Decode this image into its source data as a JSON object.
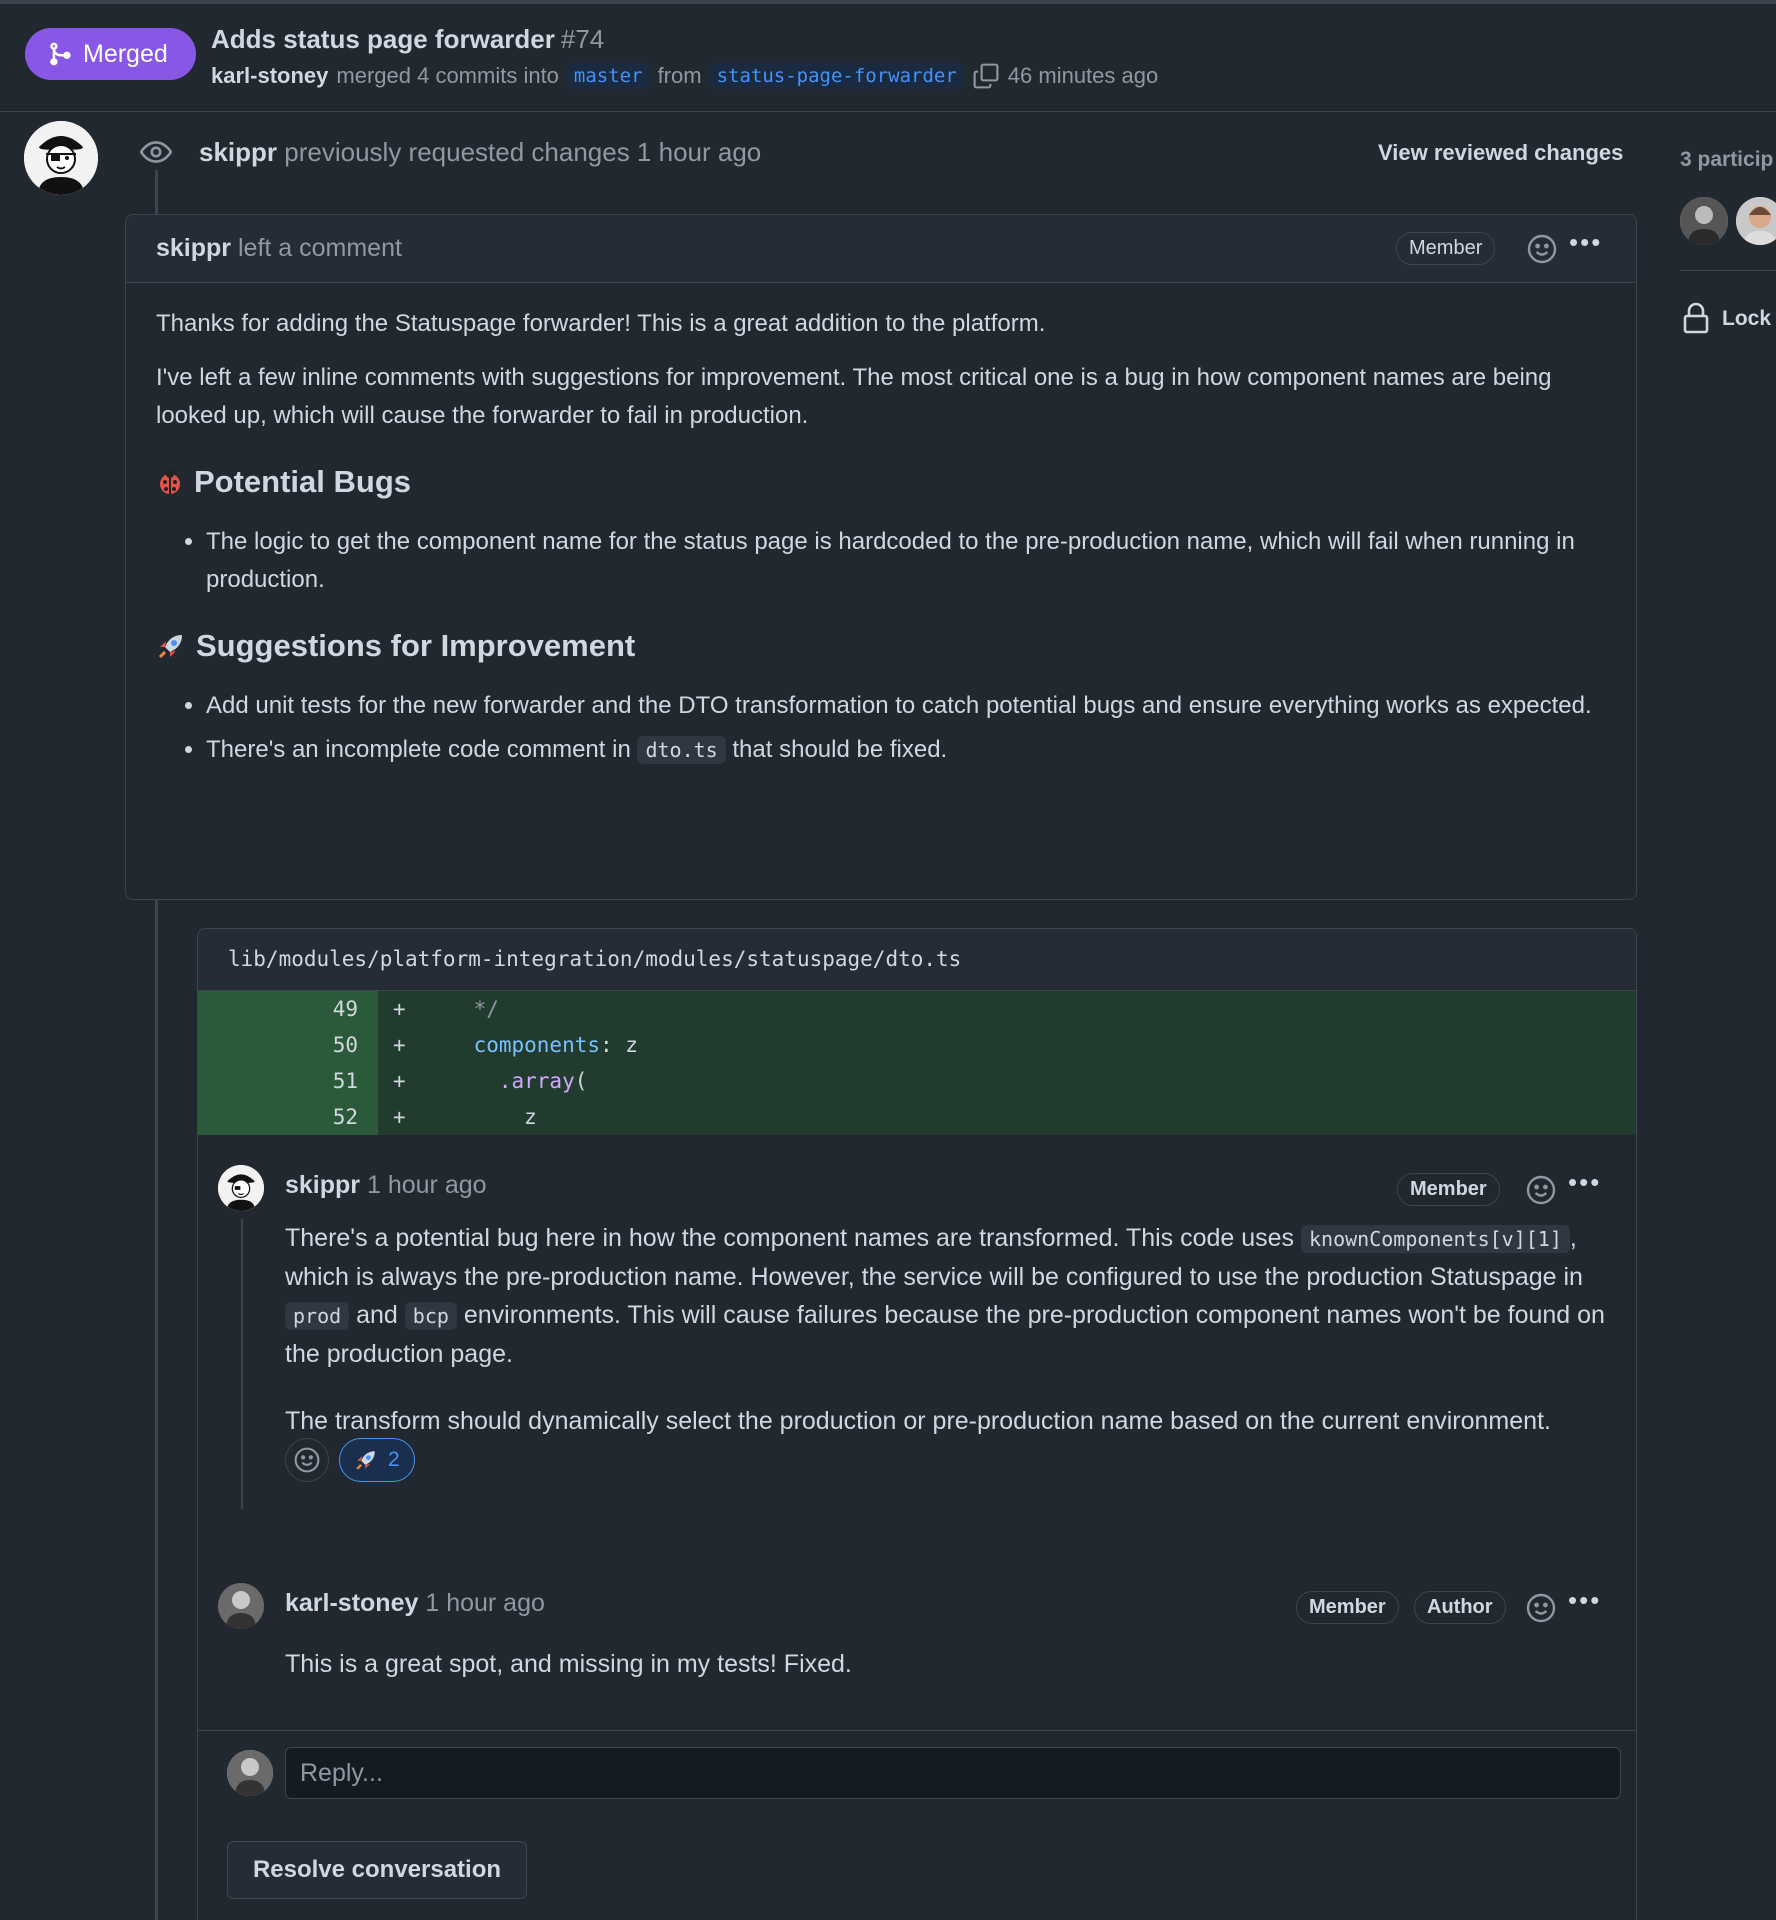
{
  "pr": {
    "status": "Merged",
    "title": "Adds status page forwarder",
    "number": "#74",
    "author": "karl-stoney",
    "merged_text": "merged 4 commits into",
    "base_branch": "master",
    "from_text": "from",
    "head_branch": "status-page-forwarder",
    "time": "46 minutes ago"
  },
  "review_event": {
    "user": "skippr",
    "text": "previously requested changes 1 hour ago",
    "view_link": "View reviewed changes"
  },
  "review": {
    "user": "skippr",
    "action": "left a comment",
    "badge": "Member",
    "p1": "Thanks for adding the Statuspage forwarder! This is a great addition to the platform.",
    "p2": "I've left a few inline comments with suggestions for improvement. The most critical one is a bug in how component names are being looked up, which will cause the forwarder to fail in production.",
    "h_bugs": "Potential Bugs",
    "bug_1": "The logic to get the component name for the status page is hardcoded to the pre-production name, which will fail when running in production.",
    "h_suggestions": "Suggestions for Improvement",
    "sugg_1": "Add unit tests for the new forwarder and the DTO transformation to catch potential bugs and ensure everything works as expected.",
    "sugg_2_pre": "There's an incomplete code comment in",
    "sugg_2_code": "dto.ts",
    "sugg_2_post": "that should be fixed."
  },
  "diff": {
    "file": "lib/modules/platform-integration/modules/statuspage/dto.ts",
    "lines": [
      {
        "n": "49",
        "sign": "+",
        "indent": "    ",
        "a": "*/",
        "b": ""
      },
      {
        "n": "50",
        "sign": "+",
        "indent": "    ",
        "a": "components",
        "b": ": z"
      },
      {
        "n": "51",
        "sign": "+",
        "indent": "      ",
        "a": ".array",
        "b": "("
      },
      {
        "n": "52",
        "sign": "+",
        "indent": "        ",
        "a": "z",
        "b": ""
      }
    ]
  },
  "comment1": {
    "user": "skippr",
    "time": "1 hour ago",
    "badge": "Member",
    "t1": "There's a potential bug here in how the component names are transformed. This code uses",
    "code1": "knownComponents[v][1]",
    "t2": ", which is always the pre-production name. However, the service will be configured to use the production Statuspage in",
    "code2": "prod",
    "t3": "and",
    "code3": "bcp",
    "t4": "environments. This will cause failures because the pre-production component names won't be found on the production page.",
    "p2": "The transform should dynamically select the production or pre-production name based on the current environment.",
    "reaction_count": "2"
  },
  "comment2": {
    "user": "karl-stoney",
    "time": "1 hour ago",
    "badge1": "Member",
    "badge2": "Author",
    "text": "This is a great spot, and missing in my tests! Fixed."
  },
  "reply": {
    "placeholder": "Reply..."
  },
  "resolve_label": "Resolve conversation",
  "sidebar": {
    "participants": "3 particip",
    "lock": "Lock"
  }
}
